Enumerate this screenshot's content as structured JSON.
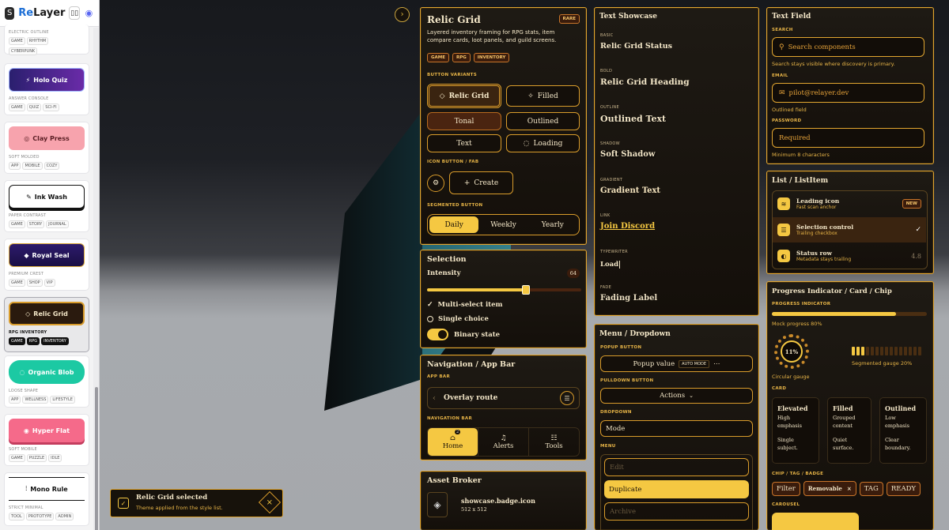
{
  "sidebar": {
    "brand": "ReLayer",
    "cards": [
      {
        "button": "",
        "meta": "ELECTRIC OUTLINE",
        "tags": [
          "GAME",
          "RHYTHM",
          "CYBERPUNK"
        ]
      },
      {
        "button": "Holo Quiz",
        "meta": "ANSWER CONSOLE",
        "tags": [
          "GAME",
          "QUIZ",
          "SCI-FI"
        ]
      },
      {
        "button": "Clay Press",
        "meta": "SOFT MOLDED",
        "tags": [
          "APP",
          "MOBILE",
          "COZY"
        ]
      },
      {
        "button": "Ink Wash",
        "meta": "PAPER CONTRAST",
        "tags": [
          "GAME",
          "STORY",
          "JOURNAL"
        ]
      },
      {
        "button": "Royal Seal",
        "meta": "PREMIUM CREST",
        "tags": [
          "GAME",
          "SHOP",
          "VIP"
        ]
      },
      {
        "button": "Relic Grid",
        "meta": "RPG INVENTORY",
        "tags": [
          "GAME",
          "RPG",
          "INVENTORY"
        ]
      },
      {
        "button": "Organic Blob",
        "meta": "LOOSE SHAPE",
        "tags": [
          "APP",
          "WELLNESS",
          "LIFESTYLE"
        ]
      },
      {
        "button": "Hyper Flat",
        "meta": "SOFT MOBILE",
        "tags": [
          "GAME",
          "PUZZLE",
          "IDLE"
        ]
      },
      {
        "button": "Mono Rule",
        "meta": "STRICT MINIMAL",
        "tags": [
          "TOOL",
          "PROTOTYPE",
          "ADMIN"
        ]
      }
    ]
  },
  "relic": {
    "title": "Relic Grid",
    "badge": "RARE",
    "desc": "Layered inventory framing for RPG stats, item compare cards, loot panels, and guild screens.",
    "chips": [
      "GAME",
      "RPG",
      "INVENTORY"
    ],
    "button_variants_label": "BUTTON VARIANTS",
    "btn_primary": "Relic Grid",
    "btn_filled": "Filled",
    "btn_tonal": "Tonal",
    "btn_outlined": "Outlined",
    "btn_text": "Text",
    "btn_loading": "Loading",
    "icon_fab_label": "ICON BUTTON / FAB",
    "fab": "Create",
    "segmented_label": "SEGMENTED BUTTON",
    "segments": [
      "Daily",
      "Weekly",
      "Yearly"
    ]
  },
  "selection": {
    "title": "Selection",
    "intensity_label": "Intensity",
    "intensity_value": 64,
    "multi": "Multi-select item",
    "single": "Single choice",
    "binary": "Binary state"
  },
  "nav": {
    "title": "Navigation / App Bar",
    "appbar_label": "APP BAR",
    "route": "Overlay route",
    "navbar_label": "NAVIGATION BAR",
    "items": [
      "Home",
      "Alerts",
      "Tools"
    ],
    "home_badge": "2"
  },
  "asset": {
    "title": "Asset Broker",
    "name": "showcase.badge.icon",
    "size": "512 x 512"
  },
  "text_showcase": {
    "title": "Text Showcase",
    "rows": [
      {
        "label": "BASIC",
        "text": "Relic Grid Status"
      },
      {
        "label": "BOLD",
        "text": "Relic Grid Heading"
      },
      {
        "label": "OUTLINE",
        "text": "Outlined Text"
      },
      {
        "label": "SHADOW",
        "text": "Soft Shadow"
      },
      {
        "label": "GRADIENT",
        "text": "Gradient Text"
      },
      {
        "label": "LINK",
        "text": "Join Discord"
      },
      {
        "label": "TYPEWRITER",
        "text": "Load"
      },
      {
        "label": "FADE",
        "text": "Fading Label"
      }
    ]
  },
  "menu": {
    "title": "Menu / Dropdown",
    "popup_label": "POPUP BUTTON",
    "popup_value": "Popup value",
    "popup_mode": "AUTO MODE",
    "pulldown_label": "PULLDOWN BUTTON",
    "pulldown_value": "Actions",
    "dropdown_label": "DROPDOWN",
    "dropdown_value": "Mode",
    "menu_label": "MENU",
    "menu_items": [
      "Edit",
      "Duplicate",
      "Archive"
    ]
  },
  "textfield": {
    "title": "Text Field",
    "search_label": "SEARCH",
    "search_placeholder": "Search components",
    "search_hint": "Search stays visible where discovery is primary.",
    "email_label": "EMAIL",
    "email_value": "pilot@relayer.dev",
    "email_hint": "Outlined field",
    "password_label": "PASSWORD",
    "password_placeholder": "Required",
    "password_hint": "Minimum 8 characters"
  },
  "list": {
    "title": "List / ListItem",
    "items": [
      {
        "title": "Leading icon",
        "sub": "Fast scan anchor",
        "trail": "NEW"
      },
      {
        "title": "Selection control",
        "sub": "Trailing checkbox",
        "trail": "✓"
      },
      {
        "title": "Status row",
        "sub": "Metadata stays trailing",
        "trail": "4.8"
      }
    ]
  },
  "progress": {
    "title": "Progress Indicator / Card / Chip",
    "indicator_label": "PROGRESS INDICATOR",
    "mock_label": "Mock progress 80%",
    "mock_value": 0.8,
    "circular_value": "11%",
    "circular_label": "Circular gauge",
    "segmented_label": "Segmented gauge 20%",
    "segmented_value": 0.2,
    "card_label": "CARD",
    "cards": [
      {
        "title": "Elevated",
        "lines": [
          "High",
          "emphasis"
        ],
        "foot": [
          "Single",
          "subject."
        ]
      },
      {
        "title": "Filled",
        "lines": [
          "Grouped",
          "content"
        ],
        "foot": [
          "Quiet",
          "surface."
        ]
      },
      {
        "title": "Outlined",
        "lines": [
          "Low",
          "emphasis"
        ],
        "foot": [
          "Clear",
          "boundary."
        ]
      }
    ],
    "chip_label": "CHIP / TAG / BADGE",
    "chips": [
      "Filter",
      "Removable",
      "TAG",
      "READY"
    ],
    "carousel_label": "CAROUSEL"
  },
  "toast": {
    "title": "Relic Grid selected",
    "sub": "Theme applied from the style list."
  },
  "colors": {
    "accent": "#f5c842",
    "border": "#e2a630",
    "panel": "#17120b"
  }
}
